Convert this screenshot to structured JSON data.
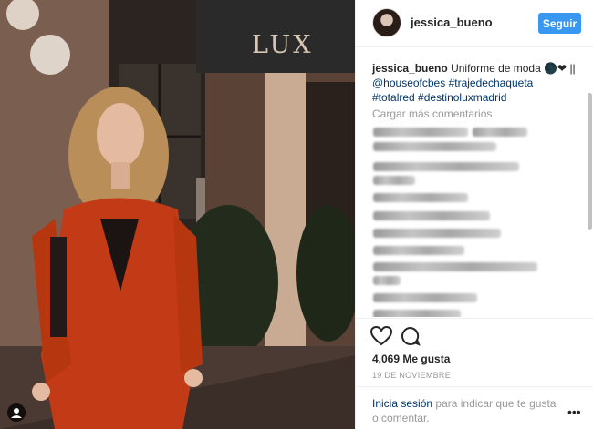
{
  "photo": {
    "sign_text": "LUX",
    "alt": "photo"
  },
  "header": {
    "username": "jessica_bueno",
    "follow_label": "Seguir"
  },
  "caption": {
    "author": "jessica_bueno",
    "text": "Uniforme de moda 🌑❤ ||",
    "mention": "@houseofcbes",
    "hashtags": [
      "#trajedechaqueta",
      "#totalred",
      "#destinoluxmadrid"
    ]
  },
  "comments": {
    "load_more": "Cargar más comentarios"
  },
  "actions": {
    "likes": "4,069 Me gusta",
    "date": "19 DE NOVIEMBRE",
    "login_link": "Inicia sesión",
    "login_rest": "para indicar que te gusta o comentar.",
    "more_icon": "more-options-icon"
  },
  "colors": {
    "accent": "#3897f0",
    "link": "#003569",
    "muted": "#999999"
  }
}
